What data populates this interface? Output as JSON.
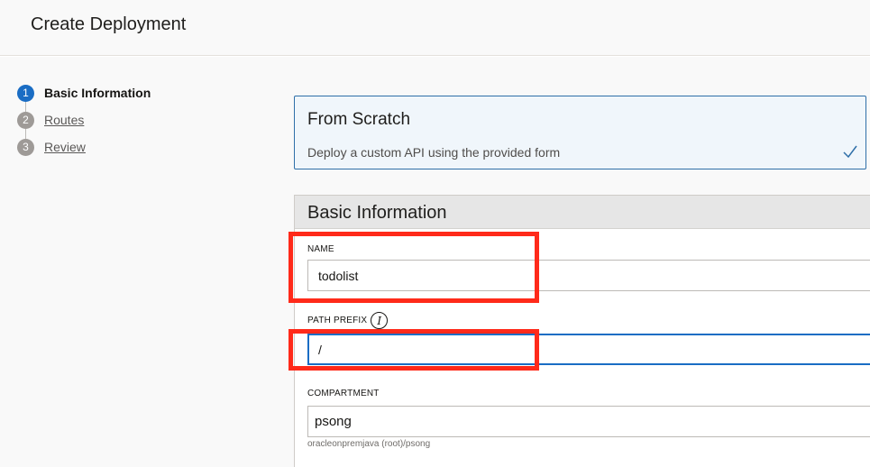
{
  "header": {
    "title": "Create Deployment"
  },
  "steps": [
    {
      "number": "1",
      "label": "Basic Information",
      "active": true
    },
    {
      "number": "2",
      "label": "Routes",
      "active": false
    },
    {
      "number": "3",
      "label": "Review",
      "active": false
    }
  ],
  "option_card": {
    "title": "From Scratch",
    "description": "Deploy a custom API using the provided form",
    "selected_icon": "checkmark-icon"
  },
  "basic_info": {
    "heading": "Basic Information",
    "name": {
      "label": "NAME",
      "value": "todolist"
    },
    "path_prefix": {
      "label": "PATH PREFIX",
      "info_icon": "i",
      "value": "/"
    },
    "compartment": {
      "label": "COMPARTMENT",
      "value": "psong",
      "helper": "oracleonpremjava (root)/psong"
    }
  },
  "colors": {
    "accent": "#1a6dc4",
    "highlight": "#ff2a1a",
    "step_inactive": "#9e9a97"
  }
}
